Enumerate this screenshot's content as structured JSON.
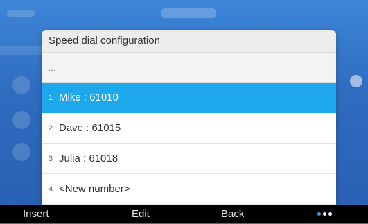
{
  "dialog": {
    "title": "Speed dial configuration",
    "ellipsis": "...",
    "entries": [
      {
        "index": "1",
        "label": "Mike : 61010",
        "selected": true
      },
      {
        "index": "2",
        "label": "Dave : 61015",
        "selected": false
      },
      {
        "index": "3",
        "label": "Julia : 61018",
        "selected": false
      },
      {
        "index": "4",
        "label": "<New number>",
        "selected": false
      }
    ]
  },
  "softkeys": {
    "insert": "Insert",
    "edit": "Edit",
    "back": "Back",
    "more_icon": "more-dots-icon"
  },
  "colors": {
    "selected_row": "#1da8ec",
    "softkey_bar": "#000000",
    "background": "#2f6cc0"
  }
}
